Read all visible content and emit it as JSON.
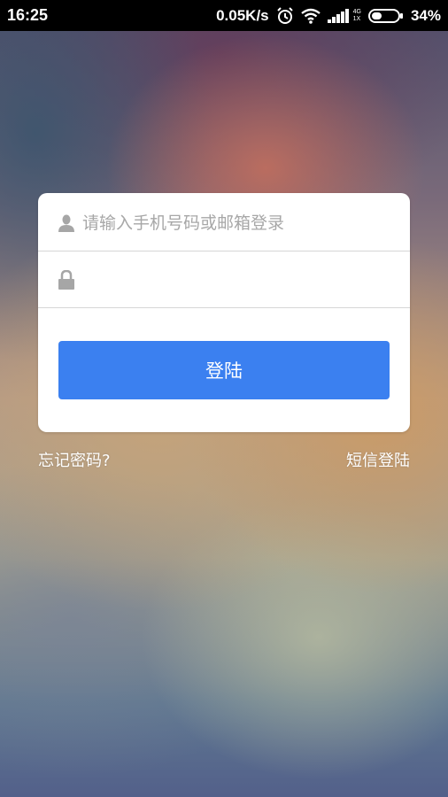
{
  "status_bar": {
    "time": "16:25",
    "net_speed": "0.05K/s",
    "network_top": "4G",
    "network_bottom": "1X",
    "battery": "34%",
    "icons": [
      "alarm-icon",
      "wifi-icon",
      "signal-icon",
      "battery-icon"
    ]
  },
  "login": {
    "username_placeholder": "请输入手机号码或邮箱登录",
    "username_value": "",
    "password_value": "",
    "submit_label": "登陆",
    "button_color": "#3b80f0"
  },
  "links": {
    "forgot_password": "忘记密码?",
    "sms_login": "短信登陆"
  }
}
